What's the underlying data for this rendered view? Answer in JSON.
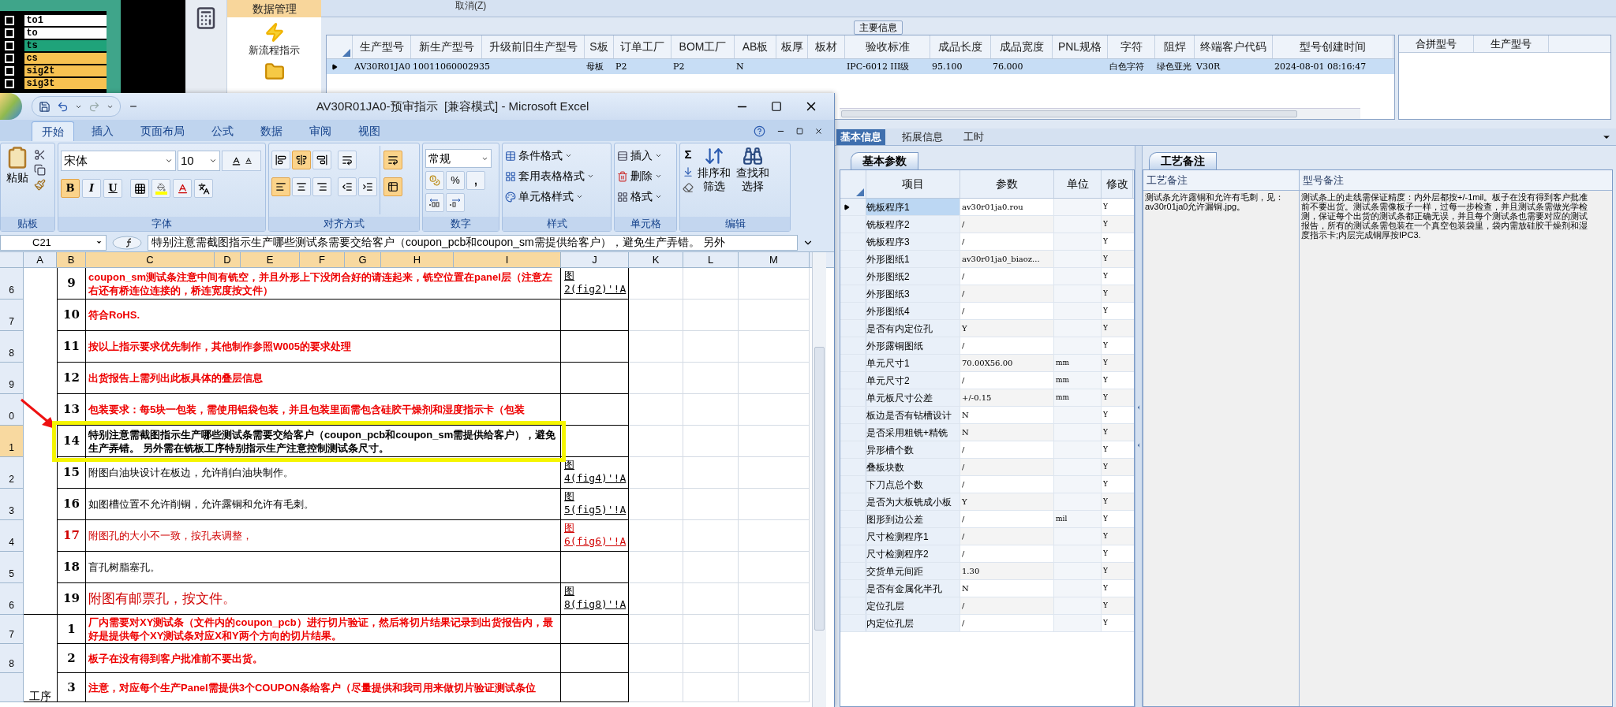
{
  "signal_list": [
    {
      "label": "to1",
      "color": "#ffffff",
      "checked": false
    },
    {
      "label": "to",
      "color": "#ffffff",
      "checked": false
    },
    {
      "label": "ts",
      "color": "#1fa37a",
      "checked": false
    },
    {
      "label": "cs",
      "color": "#f7c251",
      "checked": false
    },
    {
      "label": "sig2t",
      "color": "#f7c251",
      "checked": false
    },
    {
      "label": "sig3t",
      "color": "#f7c251",
      "checked": false
    }
  ],
  "launcher": {
    "section": "数据管理",
    "button": "新流程指示"
  },
  "toolbar": {
    "label": "取消(Z)"
  },
  "main_info": {
    "title": "主要信息",
    "columns": [
      "生产型号",
      "新生产型号",
      "升级前旧生产型号",
      "S板",
      "订单工厂",
      "BOM工厂",
      "AB板",
      "板厚",
      "板材",
      "验收标准",
      "成品长度",
      "成品宽度",
      "PNL规格",
      "字符",
      "阻焊",
      "终端客户代码",
      "型号创建时间"
    ],
    "rows": [
      {
        "selected": true,
        "cells": [
          "AV30R01JA0",
          "10011060002935",
          "",
          "母板",
          "P2",
          "P2",
          "N",
          "",
          "",
          "IPC-6012 III级",
          "95.100",
          "76.000",
          "",
          "白色字符",
          "绿色亚光",
          "V30R",
          "2024-08-01 08:16:47"
        ]
      }
    ]
  },
  "merge_table": {
    "columns": [
      "合拼型号",
      "生产型号"
    ]
  },
  "detail_tabs": [
    {
      "label": "基本信息",
      "selected": true
    },
    {
      "label": "拓展信息",
      "selected": false
    },
    {
      "label": "工时",
      "selected": false
    }
  ],
  "basic_params": {
    "tab": "基本参数",
    "columns": [
      "项目",
      "参数",
      "单位",
      "修改"
    ],
    "rows": [
      {
        "item": "铣板程序1",
        "value": "av30r01ja0.rou",
        "unit": "",
        "modify": "Y",
        "selected": true
      },
      {
        "item": "铣板程序2",
        "value": "/",
        "unit": "",
        "modify": "Y",
        "selected": false
      },
      {
        "item": "铣板程序3",
        "value": "/",
        "unit": "",
        "modify": "Y",
        "selected": false
      },
      {
        "item": "外形图纸1",
        "value": "av30r01ja0_biaoz...",
        "unit": "",
        "modify": "Y",
        "selected": false
      },
      {
        "item": "外形图纸2",
        "value": "/",
        "unit": "",
        "modify": "Y",
        "selected": false
      },
      {
        "item": "外形图纸3",
        "value": "/",
        "unit": "",
        "modify": "Y",
        "selected": false
      },
      {
        "item": "外形图纸4",
        "value": "/",
        "unit": "",
        "modify": "Y",
        "selected": false
      },
      {
        "item": "是否有内定位孔",
        "value": "Y",
        "unit": "",
        "modify": "Y",
        "selected": false
      },
      {
        "item": "外形露铜图纸",
        "value": "/",
        "unit": "",
        "modify": "Y",
        "selected": false
      },
      {
        "item": "单元尺寸1",
        "value": "70.00X56.00",
        "unit": "mm",
        "modify": "Y",
        "selected": false
      },
      {
        "item": "单元尺寸2",
        "value": "/",
        "unit": "mm",
        "modify": "Y",
        "selected": false
      },
      {
        "item": "单元板尺寸公差",
        "value": "+/-0.15",
        "unit": "mm",
        "modify": "Y",
        "selected": false
      },
      {
        "item": "板边是否有钻槽设计",
        "value": "N",
        "unit": "",
        "modify": "Y",
        "selected": false
      },
      {
        "item": "是否采用粗铣+精铣",
        "value": "N",
        "unit": "",
        "modify": "Y",
        "selected": false
      },
      {
        "item": "异形槽个数",
        "value": "/",
        "unit": "",
        "modify": "Y",
        "selected": false
      },
      {
        "item": "叠板块数",
        "value": "/",
        "unit": "",
        "modify": "Y",
        "selected": false
      },
      {
        "item": "下刀点总个数",
        "value": "/",
        "unit": "",
        "modify": "Y",
        "selected": false
      },
      {
        "item": "是否为大板铣成小板",
        "value": "Y",
        "unit": "",
        "modify": "Y",
        "selected": false
      },
      {
        "item": "图形到边公差",
        "value": "/",
        "unit": "mil",
        "modify": "Y",
        "selected": false
      },
      {
        "item": "尺寸检测程序1",
        "value": "/",
        "unit": "",
        "modify": "Y",
        "selected": false
      },
      {
        "item": "尺寸检测程序2",
        "value": "/",
        "unit": "",
        "modify": "Y",
        "selected": false
      },
      {
        "item": "交货单元间距",
        "value": "1.30",
        "unit": "",
        "modify": "Y",
        "selected": false
      },
      {
        "item": "是否有金属化半孔",
        "value": "N",
        "unit": "",
        "modify": "Y",
        "selected": false
      },
      {
        "item": "定位孔层",
        "value": "/",
        "unit": "",
        "modify": "Y",
        "selected": false
      },
      {
        "item": "内定位孔层",
        "value": "/",
        "unit": "",
        "modify": "Y",
        "selected": false
      }
    ]
  },
  "remarks": {
    "tab": "工艺备注",
    "columns": [
      "工艺备注",
      "型号备注"
    ],
    "process_note": "测试条允许露铜和允许有毛刺，见：av30r01ja0允许漏铜.jpg。",
    "model_note": "测试条上的走线需保证精度：内外层都按+/-1mil。板子在没有得到客户批准前不要出货。测试条需像板子一样，过每一步检查，并且测试条需做光学检测，保证每个出货的测试条都正确无误，并且每个测试条也需要对应的测试报告，所有的测试条需包装在一个真空包装袋里，袋内需放硅胶干燥剂和湿度指示卡;内层完成铜厚按IPC3."
  },
  "excel": {
    "title": "AV30R01JA0-预审指示  [兼容模式] - Microsoft Excel",
    "tabs": [
      {
        "label": "开始",
        "selected": true
      },
      {
        "label": "插入",
        "selected": false
      },
      {
        "label": "页面布局",
        "selected": false
      },
      {
        "label": "公式",
        "selected": false
      },
      {
        "label": "数据",
        "selected": false
      },
      {
        "label": "审阅",
        "selected": false
      },
      {
        "label": "视图",
        "selected": false
      }
    ],
    "ribbon": {
      "clipboard": {
        "label": "贴板",
        "paste": "粘贴"
      },
      "font": {
        "label": "字体",
        "family": "宋体",
        "size": "10",
        "buttons": [
          {
            "label": "B",
            "selected": true
          },
          {
            "label": "I",
            "selected": false
          },
          {
            "label": "U",
            "selected": false
          }
        ]
      },
      "alignment": {
        "label": "对齐方式",
        "vertical": [
          {
            "selected": false
          },
          {
            "selected": true
          },
          {
            "selected": false
          }
        ],
        "horizontal": [
          {
            "selected": true
          },
          {
            "selected": false
          },
          {
            "selected": false
          }
        ],
        "wrap": {
          "selected": true
        }
      },
      "number": {
        "label": "数字",
        "format": "常规",
        "percent": "%",
        "comma": ","
      },
      "styles": {
        "label": "样式",
        "items": [
          "条件格式",
          "套用表格格式",
          "单元格样式"
        ]
      },
      "cells": {
        "label": "单元格",
        "items": [
          "插入",
          "删除",
          "格式"
        ]
      },
      "editing": {
        "label": "编辑",
        "sum": "Σ",
        "sort": "排序和筛选",
        "find": "查找和选择"
      }
    },
    "name_box": "C21",
    "formula": "特别注意需截图指示生产哪些测试条需要交给客户（coupon_pcb和coupon_sm需提供给客户），避免生产弄错。 另外",
    "columns": [
      {
        "label": "A",
        "selected": false
      },
      {
        "label": "B",
        "selected": true
      },
      {
        "label": "C",
        "selected": true
      },
      {
        "label": "D",
        "selected": true
      },
      {
        "label": "E",
        "selected": true
      },
      {
        "label": "F",
        "selected": true
      },
      {
        "label": "G",
        "selected": true
      },
      {
        "label": "H",
        "selected": true
      },
      {
        "label": "I",
        "selected": true
      },
      {
        "label": "J",
        "selected": false
      },
      {
        "label": "K",
        "selected": false
      },
      {
        "label": "L",
        "selected": false
      },
      {
        "label": "M",
        "selected": false
      }
    ],
    "sections": [
      {
        "rows": [
          {
            "row_header": "6",
            "selected": false,
            "highlighted": false,
            "num": "9",
            "kind": "red_bold",
            "text": "coupon_sm测试条注意中间有铣空，并且外形上下没闭合好的请连起来，铣空位置在panel层（注意左右还有桥连位连接的，桥连宽度按文件）",
            "link": "图\n2(fig2)'!A"
          },
          {
            "row_header": "7",
            "selected": false,
            "highlighted": false,
            "num": "10",
            "kind": "red_bold",
            "text": "符合RoHS."
          },
          {
            "row_header": "8",
            "selected": false,
            "highlighted": false,
            "num": "11",
            "kind": "red_bold",
            "text": "按以上指示要求优先制作，其他制作参照W005的要求处理"
          },
          {
            "row_header": "9",
            "selected": false,
            "highlighted": false,
            "num": "12",
            "kind": "red_bold",
            "text": "出货报告上需列出此板具体的叠层信息"
          },
          {
            "row_header": "0",
            "selected": false,
            "highlighted": false,
            "num": "13",
            "kind": "red_bold",
            "text": "包装要求：每5块一包装，需使用铝袋包装，并且包装里面需包含硅胶干燥剂和湿度指示卡（包装"
          },
          {
            "row_header": "1",
            "selected": true,
            "highlighted": true,
            "num": "14",
            "kind": "black_bold",
            "text": "特别注意需截图指示生产哪些测试条需要交给客户（coupon_pcb和coupon_sm需提供给客户），避免生产弄错。 另外需在铣板工序特别指示生产注意控制测试条尺寸。"
          },
          {
            "row_header": "2",
            "selected": false,
            "highlighted": false,
            "num": "15",
            "kind": "black",
            "text": "附图白油块设计在板边，允许削白油块制作。",
            "link": "图\n4(fig4)'!A"
          },
          {
            "row_header": "3",
            "selected": false,
            "highlighted": false,
            "num": "16",
            "kind": "black",
            "text": "如图槽位置不允许削铜，允许露铜和允许有毛刺。",
            "link": "图\n5(fig5)'!A"
          },
          {
            "row_header": "4",
            "selected": false,
            "highlighted": false,
            "num": "17",
            "kind": "red",
            "text": "附图孔的大小不一致，按孔表调整，",
            "link": "图\n6(fig6)'!A"
          },
          {
            "row_header": "5",
            "selected": false,
            "highlighted": false,
            "num": "18",
            "kind": "black",
            "text": "盲孔树脂塞孔。"
          },
          {
            "row_header": "6",
            "selected": false,
            "highlighted": false,
            "num": "19",
            "kind": "red_large",
            "text": "附图有邮票孔，按文件。",
            "link": "图\n8(fig8)'!A"
          }
        ]
      },
      {
        "group": "工序",
        "rows": [
          {
            "row_header": "7",
            "selected": false,
            "highlighted": false,
            "num": "1",
            "kind": "red_bold",
            "text": "厂内需要对XY测试条（文件内的coupon_pcb）进行切片验证，然后将切片结果记录到出货报告内，最好是提供每个XY测试条对应X和Y两个方向的切片结果。"
          },
          {
            "row_header": "8",
            "selected": false,
            "highlighted": false,
            "num": "2",
            "kind": "red_bold",
            "text": "板子在没有得到客户批准前不要出货。"
          },
          {
            "selected": false,
            "highlighted": false,
            "num": "3",
            "kind": "red_bold",
            "text": "注意，对应每个生产Panel需提供3个COUPON条给客户（尽量提供和我司用来做切片验证测试条位"
          }
        ]
      }
    ]
  }
}
